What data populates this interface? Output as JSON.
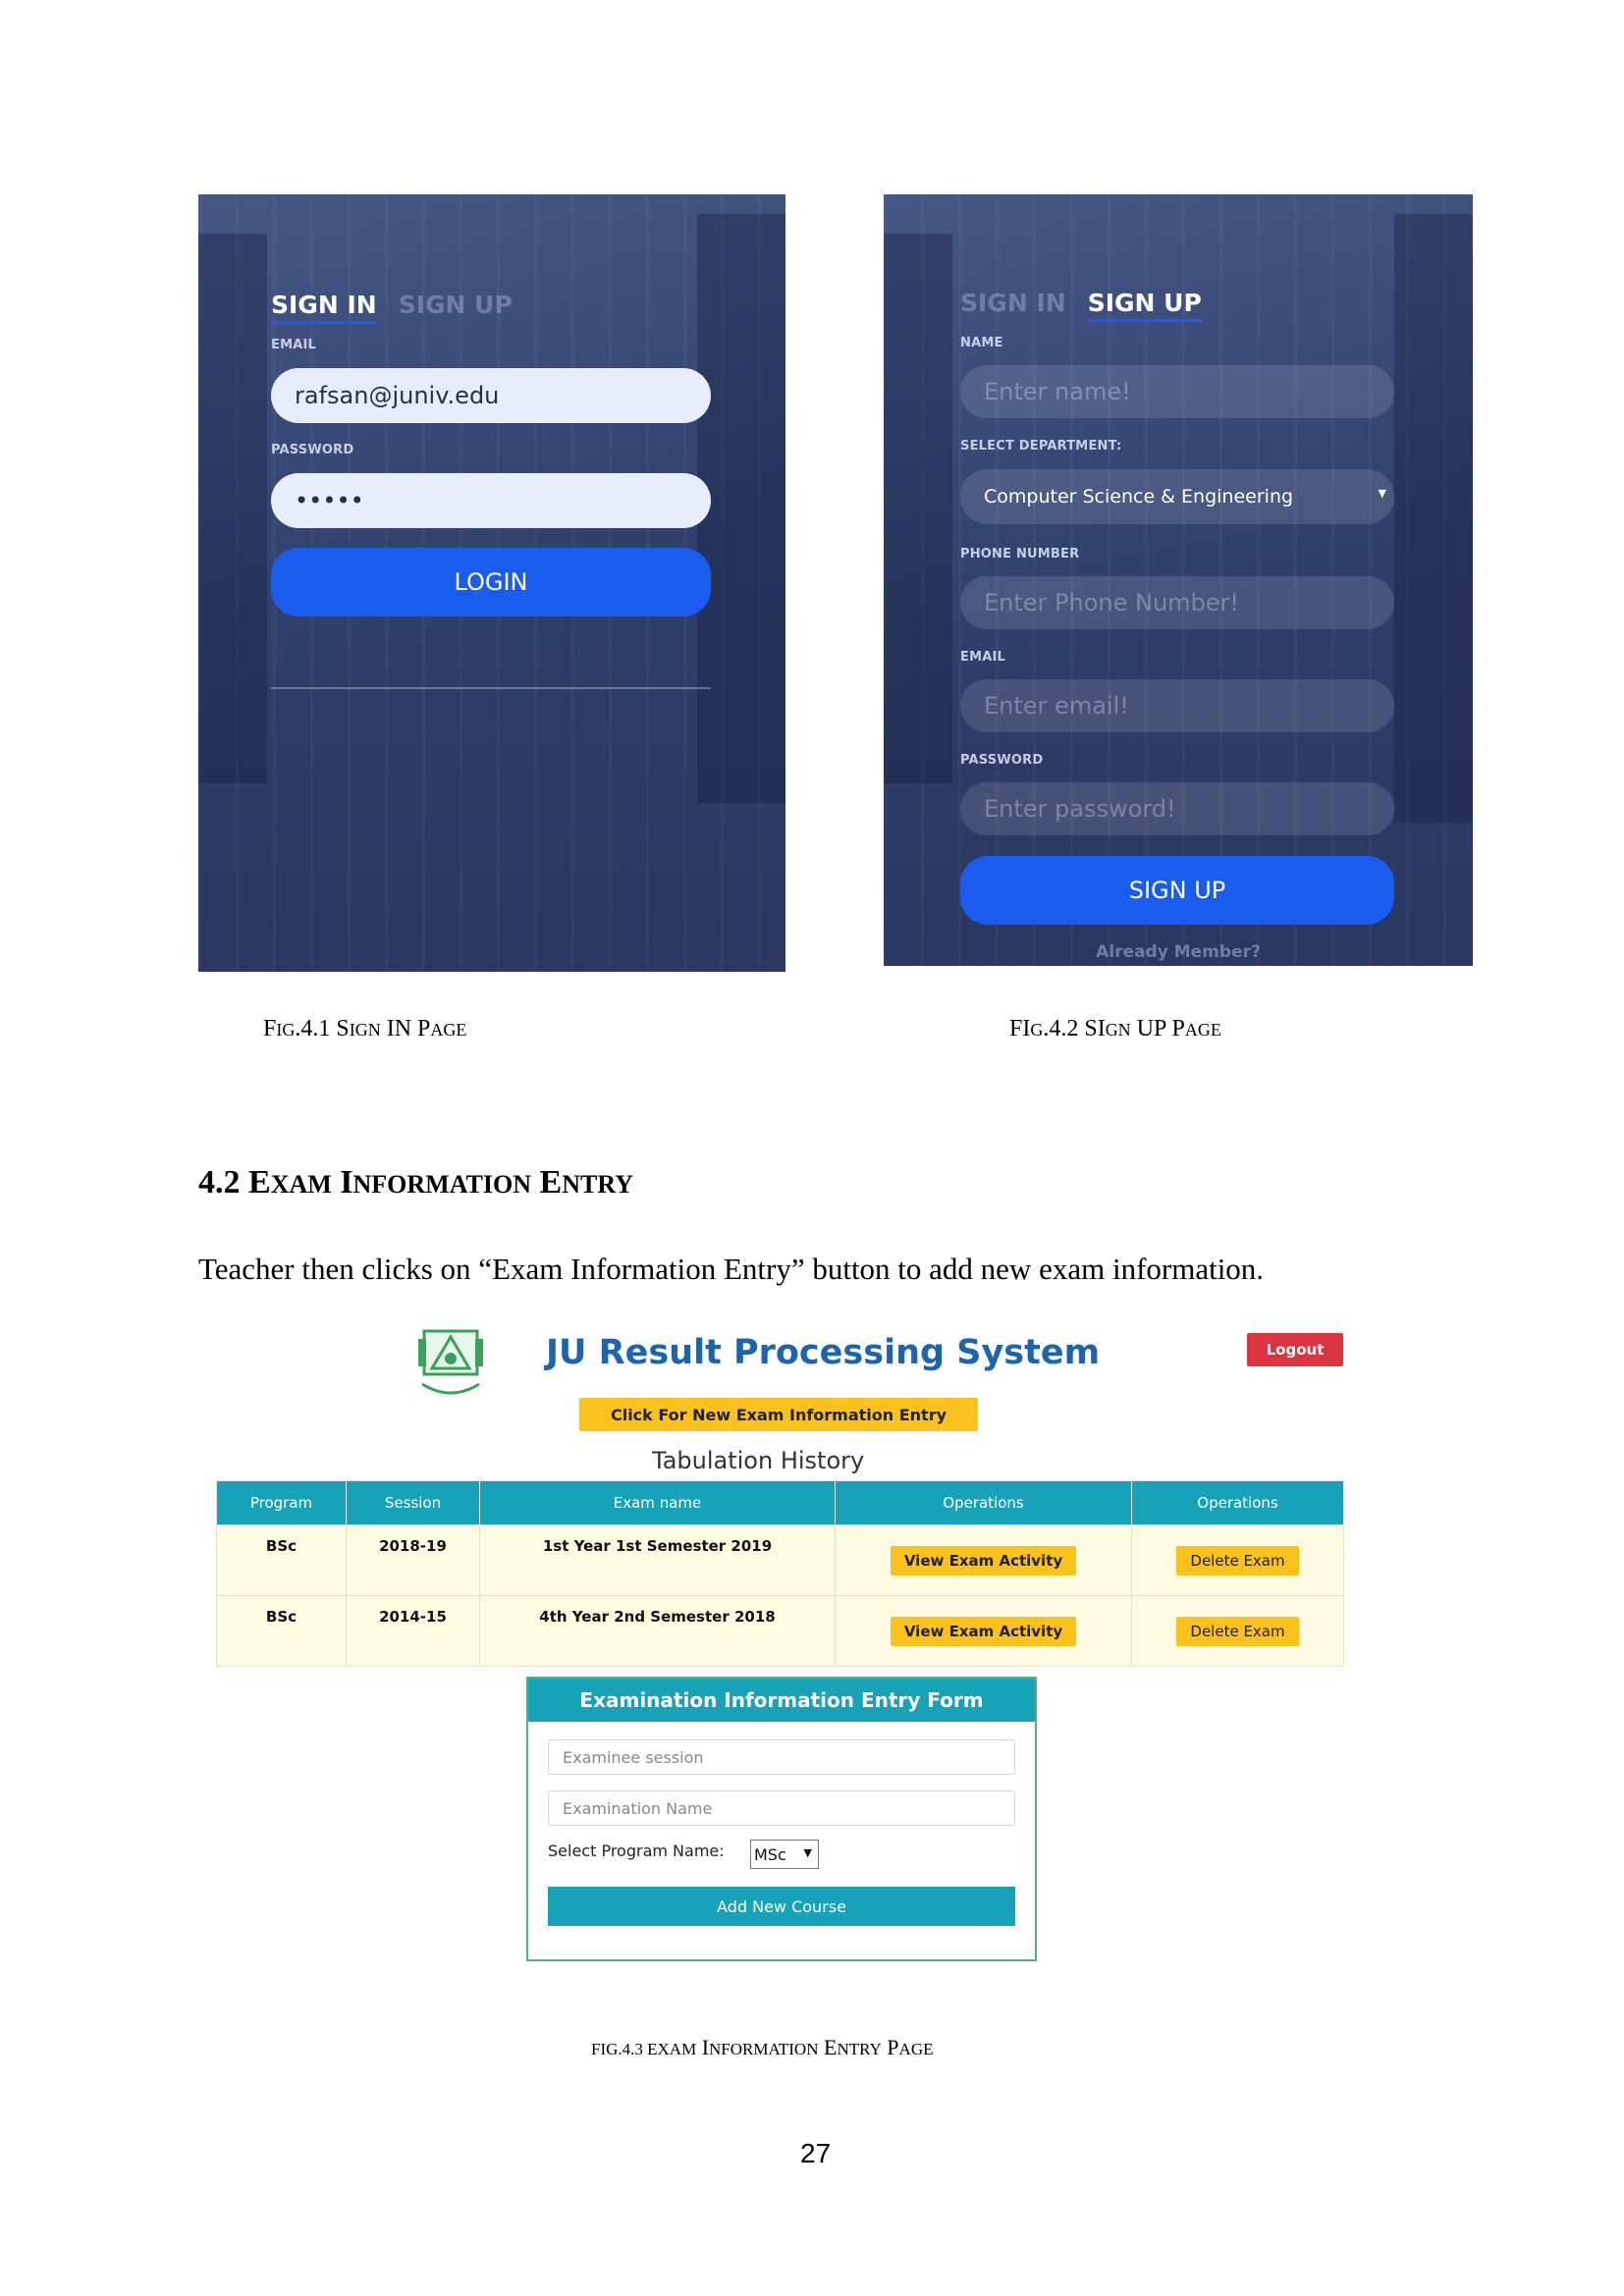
{
  "signin": {
    "tab_signin": "SIGN IN",
    "tab_signup": "SIGN UP",
    "email_label": "EMAIL",
    "email_value": "rafsan@juniv.edu",
    "password_label": "PASSWORD",
    "password_value": "•••••",
    "login_button": "LOGIN"
  },
  "signup": {
    "tab_signin": "SIGN IN",
    "tab_signup": "SIGN UP",
    "name_label": "NAME",
    "name_placeholder": "Enter name!",
    "dept_label": "SELECT DEPARTMENT:",
    "dept_value": "Computer Science & Engineering",
    "phone_label": "PHONE NUMBER",
    "phone_placeholder": "Enter Phone Number!",
    "email_label": "EMAIL",
    "email_placeholder": "Enter email!",
    "password_label": "PASSWORD",
    "password_placeholder": "Enter password!",
    "signup_button": "SIGN UP",
    "already_member": "Already Member?"
  },
  "captions": {
    "fig1_a": "F",
    "fig1_b": "IG",
    "fig1_c": ".4.1 S",
    "fig1_d": "IGN",
    "fig1_e": " IN P",
    "fig1_f": "AGE",
    "fig2_a": "FI",
    "fig2_b": "G",
    "fig2_c": ".4.2 SI",
    "fig2_d": "GN",
    "fig2_e": " UP P",
    "fig2_f": "AGE",
    "fig3_a": "FIG.4.3 E",
    "fig3_b": "XAM",
    "fig3_c": " I",
    "fig3_d": "NFORMATION",
    "fig3_e": " E",
    "fig3_f": "NTRY",
    "fig3_g": " P",
    "fig3_h": "AGE"
  },
  "section": {
    "heading_a": "4.2 E",
    "heading_b": "XAM",
    "heading_c": " I",
    "heading_d": "NFORMATION",
    "heading_e": " E",
    "heading_f": "NTRY",
    "paragraph": "Teacher then clicks on “Exam Information Entry” button to add new exam information."
  },
  "ju": {
    "title": "JU Result Processing System",
    "logout": "Logout",
    "new_entry_button": "Click For New Exam Information Entry",
    "history_title": "Tabulation History",
    "columns": [
      "Program",
      "Session",
      "Exam name",
      "Operations",
      "Operations"
    ],
    "rows": [
      {
        "program": "BSc",
        "session": "2018-19",
        "exam": "1st Year 1st Semester 2019",
        "view": "View Exam Activity",
        "delete": "Delete Exam"
      },
      {
        "program": "BSc",
        "session": "2014-15",
        "exam": "4th Year 2nd Semester 2018",
        "view": "View Exam Activity",
        "delete": "Delete Exam"
      }
    ],
    "form": {
      "title": "Examination Information Entry Form",
      "session_placeholder": "Examinee session",
      "name_placeholder": "Examination Name",
      "program_label": "Select Program Name:",
      "program_value": "MSc",
      "add_button": "Add New Course"
    }
  },
  "page_number": "27"
}
